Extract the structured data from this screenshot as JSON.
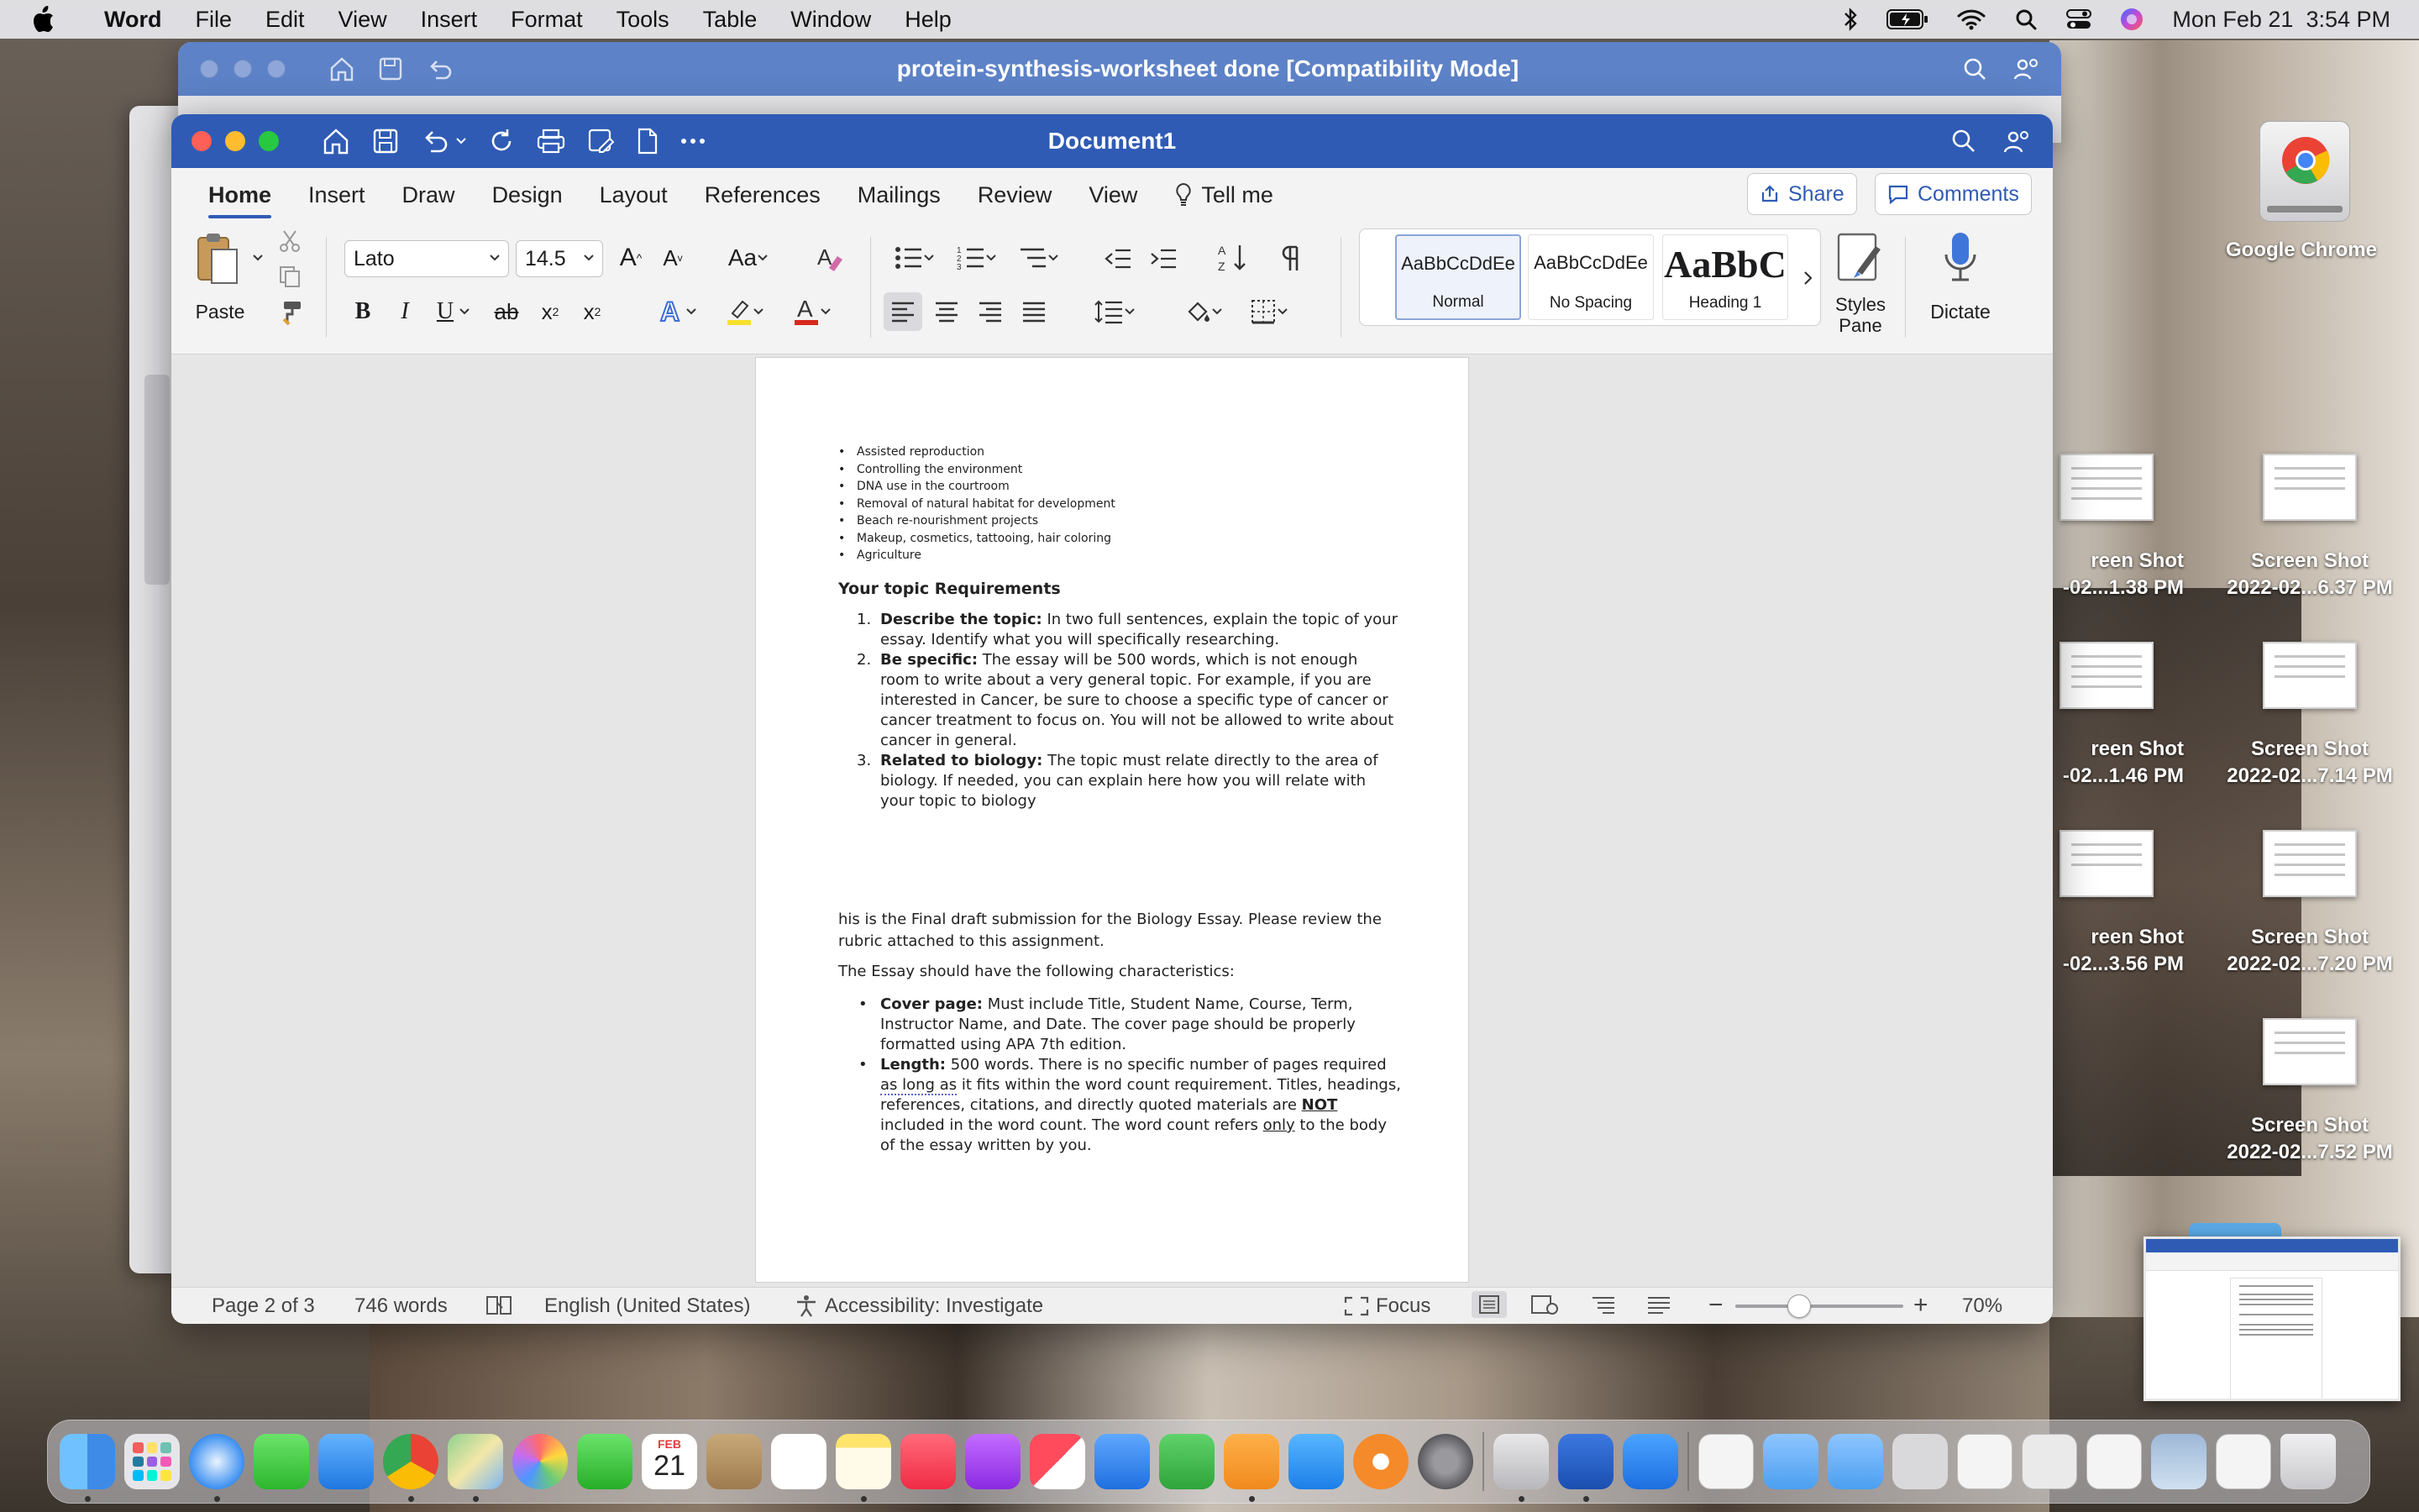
{
  "menubar": {
    "app_name": "Word",
    "items": [
      "File",
      "Edit",
      "View",
      "Insert",
      "Format",
      "Tools",
      "Table",
      "Window",
      "Help"
    ],
    "datetime": "Mon Feb 21  3:54 PM"
  },
  "back_window": {
    "title": "protein-synthesis-worksheet done [Compatibility Mode]"
  },
  "word": {
    "title": "Document1",
    "tabs": [
      "Home",
      "Insert",
      "Draw",
      "Design",
      "Layout",
      "References",
      "Mailings",
      "Review",
      "View"
    ],
    "tell_me": "Tell me",
    "share_label": "Share",
    "comments_label": "Comments",
    "paste_label": "Paste",
    "font_name": "Lato",
    "font_size": "14.5",
    "styles": [
      {
        "sample": "AaBbCcDdEe",
        "name": "Normal"
      },
      {
        "sample": "AaBbCcDdEe",
        "name": "No Spacing"
      },
      {
        "sample": "AaBbC",
        "name": "Heading 1"
      }
    ],
    "styles_pane_label": "Styles\nPane",
    "dictate_label": "Dictate"
  },
  "document": {
    "bullets_top": [
      "Assisted reproduction",
      "Controlling the environment",
      "DNA use in the courtroom",
      "Removal of natural habitat for development",
      "Beach re-nourishment projects",
      "Makeup, cosmetics, tattooing, hair coloring",
      "Agriculture"
    ],
    "heading": "Your topic Requirements",
    "requirements": [
      {
        "num": "1.",
        "lead": "Describe the topic:",
        "text": " In two full sentences, explain the topic of your essay. Identify what you will specifically researching."
      },
      {
        "num": "2.",
        "lead": "Be specific:",
        "text": " The essay will be 500 words, which is not enough room to write about a very general topic. For example, if you are interested in Cancer, be sure to choose a specific type of cancer or cancer treatment to focus on. You will not be allowed to write about cancer in general."
      },
      {
        "num": "3.",
        "lead": "Related to biology:",
        "text": " The topic must relate directly to the area of biology. If needed, you can explain here how you will relate with your topic to biology"
      }
    ],
    "para1": "his is the Final draft submission for the Biology Essay. Please review the rubric attached to this assignment.",
    "para2": "The Essay should have the following characteristics:",
    "cover_lead": "Cover page:",
    "cover_text": " Must include Title, Student Name, Course, Term, Instructor Name, and Date. The cover page should be properly formatted using APA 7th edition.",
    "length_lead": "Length:",
    "length_text1": " 500 words. There is no specific number of pages required ",
    "length_dotted": "as long as",
    "length_text2": " it fits within the word count requirement. Titles, headings, references, citations, and directly quoted materials are ",
    "length_not": "NOT",
    "length_text3": " included in the word count. The word count refers ",
    "length_only": "only",
    "length_text4": " to the body of the essay written by you."
  },
  "statusbar": {
    "page": "Page 2 of 3",
    "words": "746 words",
    "language": "English (United States)",
    "accessibility": "Accessibility: Investigate",
    "focus": "Focus",
    "zoom": "70%"
  },
  "desktop": {
    "chrome_label": "Google Chrome",
    "screenshots": [
      {
        "line1": "reen Shot",
        "line2": "-02...1.38 PM"
      },
      {
        "line1": "Screen Shot",
        "line2": "2022-02...6.37 PM"
      },
      {
        "line1": "reen Shot",
        "line2": "-02...1.46 PM"
      },
      {
        "line1": "Screen Shot",
        "line2": "2022-02...7.14 PM"
      },
      {
        "line1": "reen Shot",
        "line2": "-02...3.56 PM"
      },
      {
        "line1": "Screen Shot",
        "line2": "2022-02...7.20 PM"
      },
      {
        "line1": "Screen Shot",
        "line2": "2022-02...7.52 PM"
      }
    ]
  },
  "calendar_icon": {
    "month": "FEB",
    "day": "21"
  },
  "colors": {
    "word_blue": "#2f5bb5",
    "page": "#ffffff",
    "ribbon": "#f3f3f3"
  }
}
